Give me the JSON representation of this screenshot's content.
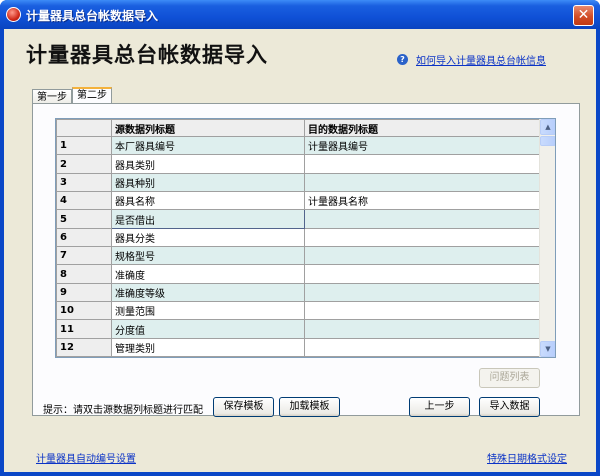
{
  "window": {
    "title": "计量器具总台帐数据导入",
    "close_glyph": "✕"
  },
  "heading": "计量器具总台帐数据导入",
  "help_link": "如何导入计量器具总台帐信息",
  "tabs": [
    {
      "label": "第一步",
      "active": false
    },
    {
      "label": "第二步",
      "active": true
    }
  ],
  "grid": {
    "columns": [
      "",
      "源数据列标题",
      "目的数据列标题"
    ],
    "rows": [
      {
        "num": "1",
        "source": "本厂器具编号",
        "target": "计量器具编号"
      },
      {
        "num": "2",
        "source": "器具类别",
        "target": ""
      },
      {
        "num": "3",
        "source": "器具种别",
        "target": ""
      },
      {
        "num": "4",
        "source": "器具名称",
        "target": "计量器具名称"
      },
      {
        "num": "5",
        "source": "是否借出",
        "target": "",
        "selected": true
      },
      {
        "num": "6",
        "source": "器具分类",
        "target": ""
      },
      {
        "num": "7",
        "source": "规格型号",
        "target": ""
      },
      {
        "num": "8",
        "source": "准确度",
        "target": ""
      },
      {
        "num": "9",
        "source": "准确度等级",
        "target": ""
      },
      {
        "num": "10",
        "source": "测量范围",
        "target": ""
      },
      {
        "num": "11",
        "source": "分度值",
        "target": ""
      },
      {
        "num": "12",
        "source": "管理类别",
        "target": ""
      }
    ]
  },
  "buttons": {
    "issue_list": "问题列表",
    "save_template": "保存模板",
    "load_template": "加载模板",
    "prev_step": "上一步",
    "import_data": "导入数据"
  },
  "hint": "提示：请双击源数据列标题进行匹配",
  "footer": {
    "auto_numbering": "计量器具自动编号设置",
    "date_format": "特殊日期格式设定"
  },
  "icons": {
    "help": "?",
    "scroll_up": "▲",
    "scroll_down": "▼"
  }
}
